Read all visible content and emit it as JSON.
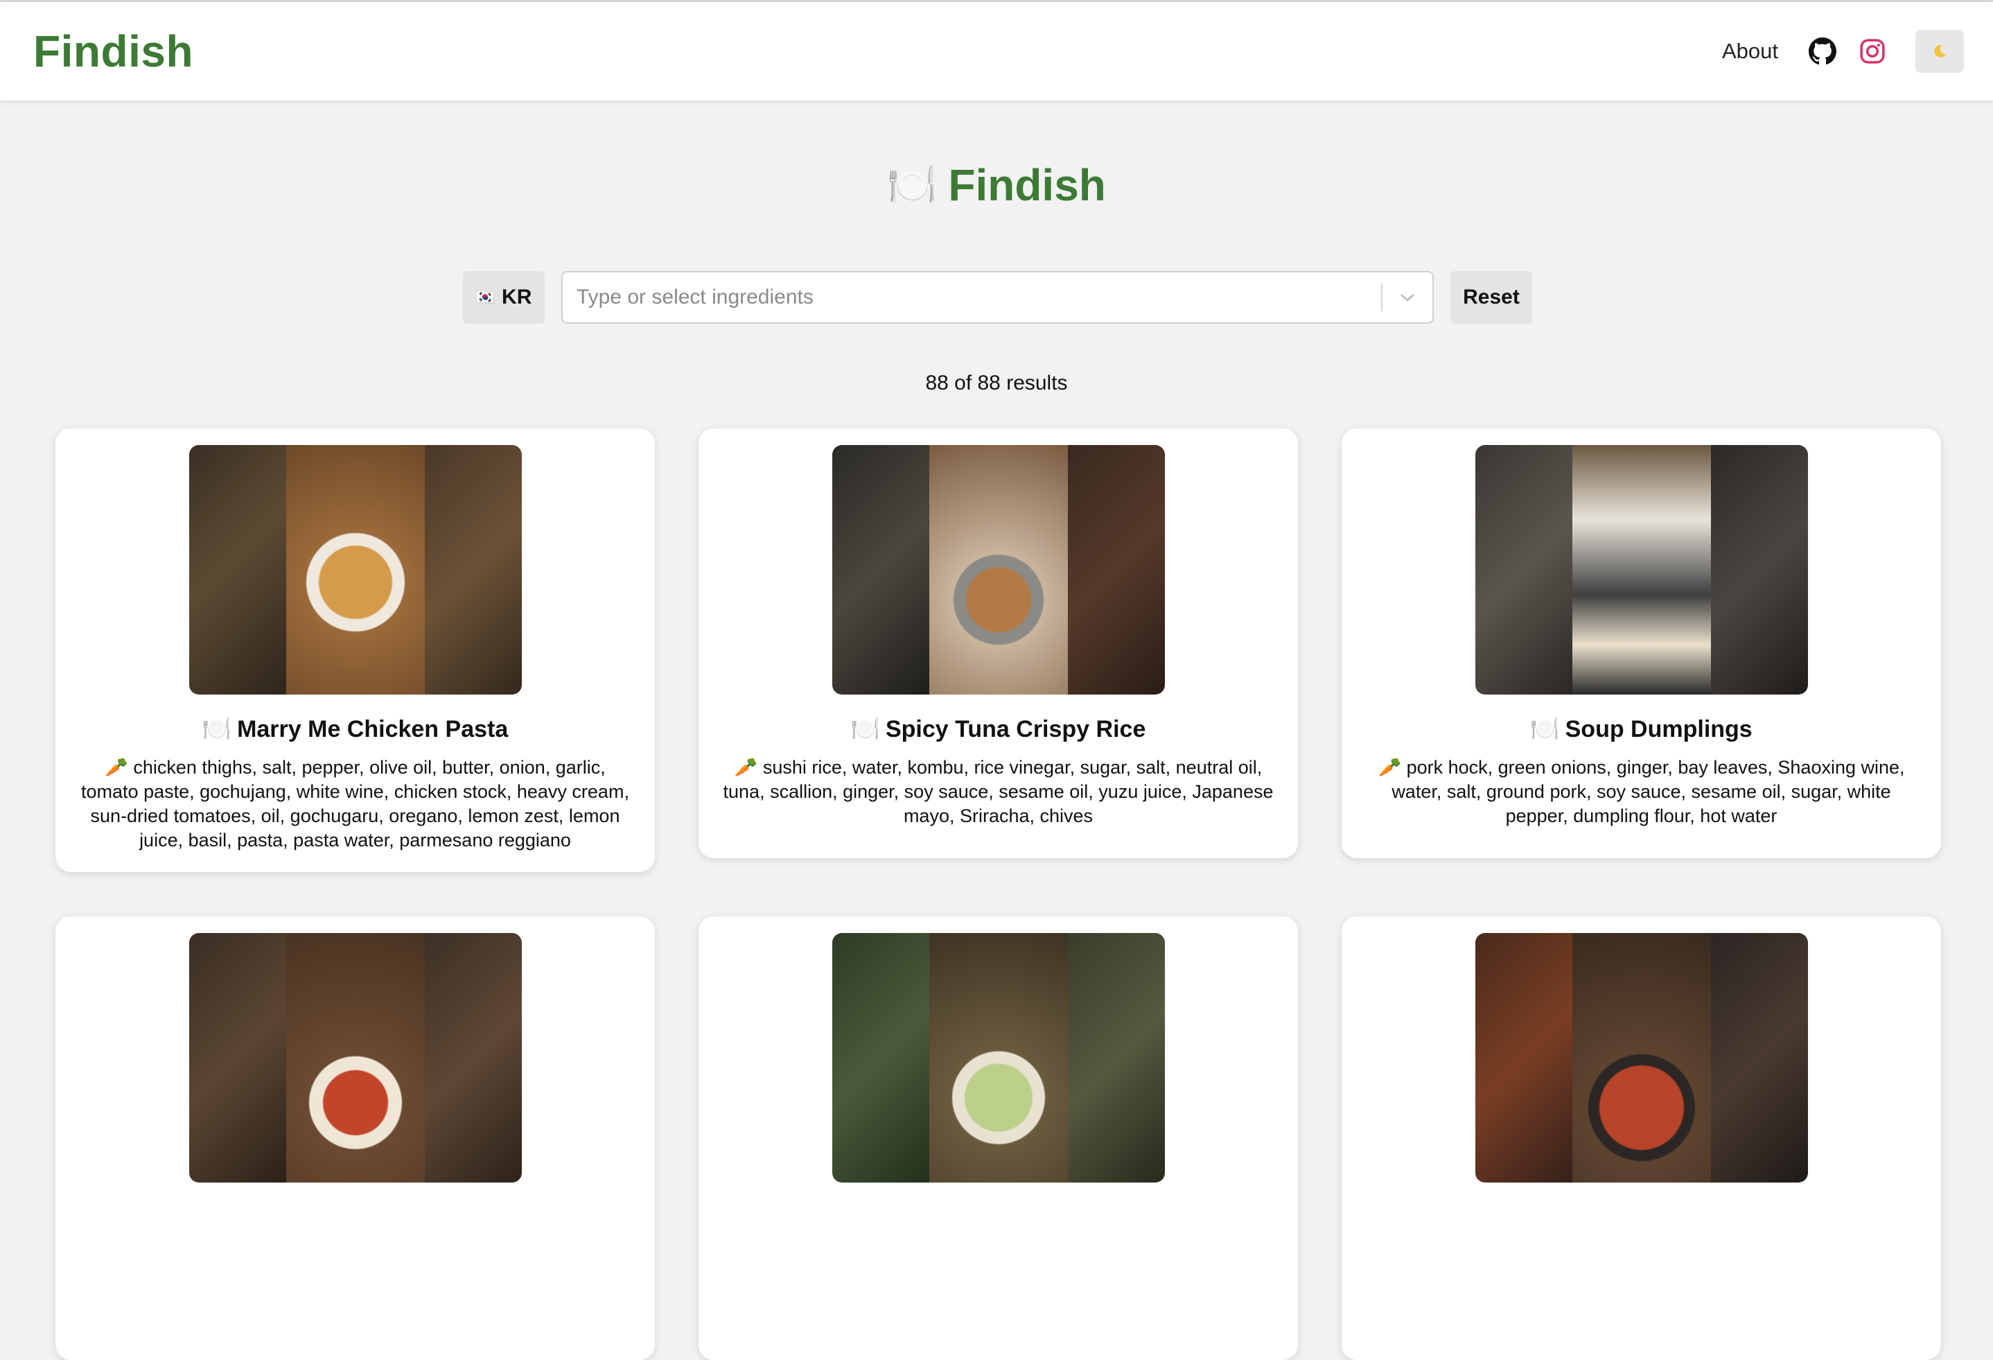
{
  "header": {
    "brand": "Findish",
    "about": "About",
    "github_icon": "github-icon",
    "instagram_icon": "instagram-icon",
    "theme_icon": "moon-icon"
  },
  "hero": {
    "title": "Findish",
    "icon": "plate-icon",
    "icon_glyph": "🍽️"
  },
  "search": {
    "lang_flag": "🇰🇷",
    "lang_label": "KR",
    "placeholder": "Type or select ingredients",
    "reset": "Reset"
  },
  "results": {
    "count_text": "88 of 88 results"
  },
  "icons": {
    "title_glyph": "🍽️",
    "ing_glyph": "🥕"
  },
  "recipes": [
    {
      "title": "Marry Me Chicken Pasta",
      "ingredients": "chicken thighs, salt, pepper, olive oil, butter, onion, garlic, tomato paste, gochujang, white wine, chicken stock, heavy cream, sun-dried tomatoes, oil, gochugaru, oregano, lemon zest, lemon juice, basil, pasta, pasta water, parmesano reggiano"
    },
    {
      "title": "Spicy Tuna Crispy Rice",
      "ingredients": "sushi rice, water, kombu, rice vinegar, sugar, salt, neutral oil, tuna, scallion, ginger, soy sauce, sesame oil, yuzu juice, Japanese mayo, Sriracha, chives"
    },
    {
      "title": "Soup Dumplings",
      "ingredients": "pork hock, green onions, ginger, bay leaves, Shaoxing wine, water, salt, ground pork, soy sauce, sesame oil, sugar, white pepper, dumpling flour, hot water"
    },
    {
      "title": "",
      "ingredients": ""
    },
    {
      "title": "",
      "ingredients": ""
    },
    {
      "title": "",
      "ingredients": ""
    }
  ],
  "colors": {
    "brand": "#3d7a35",
    "page_bg": "#f2f2f2",
    "instagram": "#d6336c"
  }
}
